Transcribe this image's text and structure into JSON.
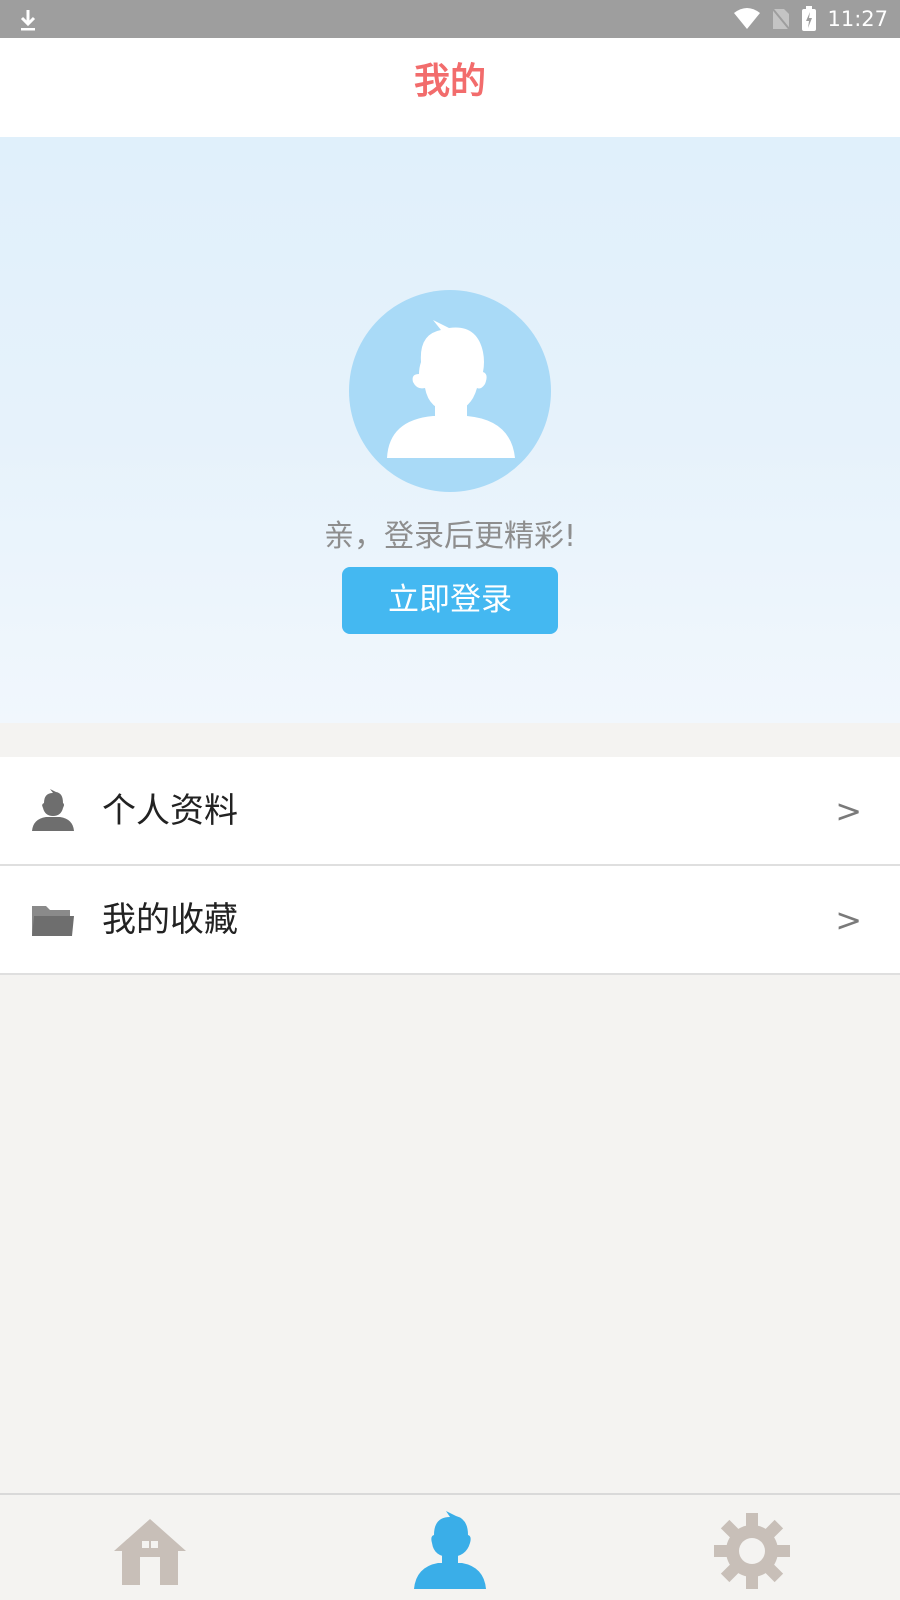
{
  "status_bar": {
    "time": "11:27",
    "icons": [
      "download-icon",
      "wifi-icon",
      "no-sim-icon",
      "battery-charging-icon"
    ]
  },
  "header": {
    "title": "我的",
    "title_color": "#f26c6c"
  },
  "profile": {
    "avatar_icon": "user-silhouette-icon",
    "login_hint": "亲，登录后更精彩!",
    "login_button_label": "立即登录",
    "accent_color": "#44b8f1"
  },
  "menu": {
    "items": [
      {
        "label": "个人资料",
        "icon": "person-icon",
        "chevron": ">"
      },
      {
        "label": "我的收藏",
        "icon": "folder-icon",
        "chevron": ">"
      }
    ]
  },
  "bottom_nav": {
    "items": [
      {
        "icon": "home-icon",
        "active": false
      },
      {
        "icon": "profile-icon",
        "active": true
      },
      {
        "icon": "settings-icon",
        "active": false
      }
    ],
    "active_color": "#3aaee8"
  }
}
